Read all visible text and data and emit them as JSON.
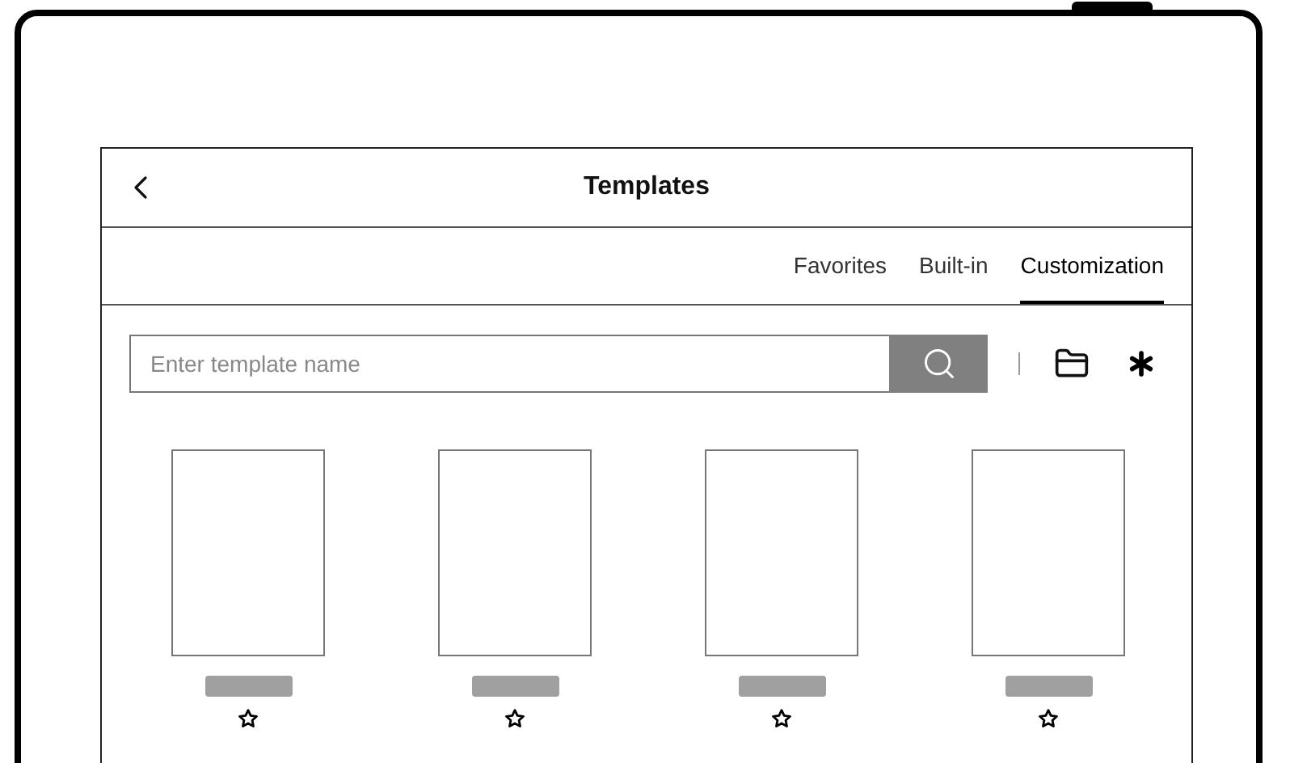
{
  "screen": {
    "title": "Templates"
  },
  "tabs": [
    {
      "label": "Favorites",
      "selected": false
    },
    {
      "label": "Built-in",
      "selected": false
    },
    {
      "label": "Customization",
      "selected": true
    }
  ],
  "search": {
    "placeholder": "Enter template name"
  },
  "templates": [
    {
      "favorite": false
    },
    {
      "favorite": false
    },
    {
      "favorite": false
    },
    {
      "favorite": false
    }
  ]
}
